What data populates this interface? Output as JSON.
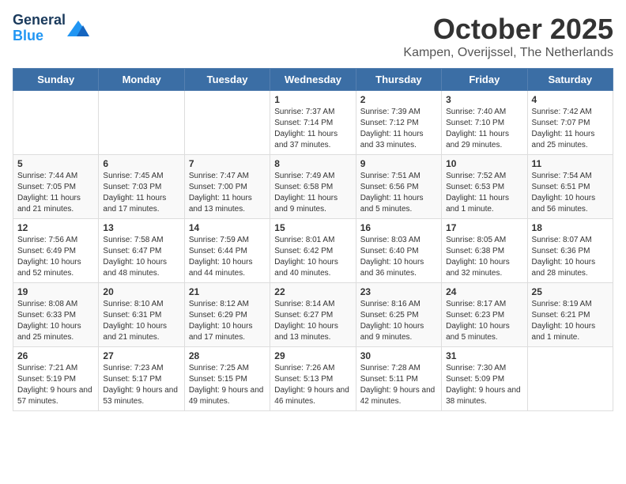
{
  "app": {
    "name": "GeneralBlue",
    "logo_color": "#2196f3"
  },
  "header": {
    "month": "October 2025",
    "location": "Kampen, Overijssel, The Netherlands"
  },
  "weekdays": [
    "Sunday",
    "Monday",
    "Tuesday",
    "Wednesday",
    "Thursday",
    "Friday",
    "Saturday"
  ],
  "weeks": [
    [
      {
        "day": "",
        "info": ""
      },
      {
        "day": "",
        "info": ""
      },
      {
        "day": "",
        "info": ""
      },
      {
        "day": "1",
        "info": "Sunrise: 7:37 AM\nSunset: 7:14 PM\nDaylight: 11 hours and 37 minutes."
      },
      {
        "day": "2",
        "info": "Sunrise: 7:39 AM\nSunset: 7:12 PM\nDaylight: 11 hours and 33 minutes."
      },
      {
        "day": "3",
        "info": "Sunrise: 7:40 AM\nSunset: 7:10 PM\nDaylight: 11 hours and 29 minutes."
      },
      {
        "day": "4",
        "info": "Sunrise: 7:42 AM\nSunset: 7:07 PM\nDaylight: 11 hours and 25 minutes."
      }
    ],
    [
      {
        "day": "5",
        "info": "Sunrise: 7:44 AM\nSunset: 7:05 PM\nDaylight: 11 hours and 21 minutes."
      },
      {
        "day": "6",
        "info": "Sunrise: 7:45 AM\nSunset: 7:03 PM\nDaylight: 11 hours and 17 minutes."
      },
      {
        "day": "7",
        "info": "Sunrise: 7:47 AM\nSunset: 7:00 PM\nDaylight: 11 hours and 13 minutes."
      },
      {
        "day": "8",
        "info": "Sunrise: 7:49 AM\nSunset: 6:58 PM\nDaylight: 11 hours and 9 minutes."
      },
      {
        "day": "9",
        "info": "Sunrise: 7:51 AM\nSunset: 6:56 PM\nDaylight: 11 hours and 5 minutes."
      },
      {
        "day": "10",
        "info": "Sunrise: 7:52 AM\nSunset: 6:53 PM\nDaylight: 11 hours and 1 minute."
      },
      {
        "day": "11",
        "info": "Sunrise: 7:54 AM\nSunset: 6:51 PM\nDaylight: 10 hours and 56 minutes."
      }
    ],
    [
      {
        "day": "12",
        "info": "Sunrise: 7:56 AM\nSunset: 6:49 PM\nDaylight: 10 hours and 52 minutes."
      },
      {
        "day": "13",
        "info": "Sunrise: 7:58 AM\nSunset: 6:47 PM\nDaylight: 10 hours and 48 minutes."
      },
      {
        "day": "14",
        "info": "Sunrise: 7:59 AM\nSunset: 6:44 PM\nDaylight: 10 hours and 44 minutes."
      },
      {
        "day": "15",
        "info": "Sunrise: 8:01 AM\nSunset: 6:42 PM\nDaylight: 10 hours and 40 minutes."
      },
      {
        "day": "16",
        "info": "Sunrise: 8:03 AM\nSunset: 6:40 PM\nDaylight: 10 hours and 36 minutes."
      },
      {
        "day": "17",
        "info": "Sunrise: 8:05 AM\nSunset: 6:38 PM\nDaylight: 10 hours and 32 minutes."
      },
      {
        "day": "18",
        "info": "Sunrise: 8:07 AM\nSunset: 6:36 PM\nDaylight: 10 hours and 28 minutes."
      }
    ],
    [
      {
        "day": "19",
        "info": "Sunrise: 8:08 AM\nSunset: 6:33 PM\nDaylight: 10 hours and 25 minutes."
      },
      {
        "day": "20",
        "info": "Sunrise: 8:10 AM\nSunset: 6:31 PM\nDaylight: 10 hours and 21 minutes."
      },
      {
        "day": "21",
        "info": "Sunrise: 8:12 AM\nSunset: 6:29 PM\nDaylight: 10 hours and 17 minutes."
      },
      {
        "day": "22",
        "info": "Sunrise: 8:14 AM\nSunset: 6:27 PM\nDaylight: 10 hours and 13 minutes."
      },
      {
        "day": "23",
        "info": "Sunrise: 8:16 AM\nSunset: 6:25 PM\nDaylight: 10 hours and 9 minutes."
      },
      {
        "day": "24",
        "info": "Sunrise: 8:17 AM\nSunset: 6:23 PM\nDaylight: 10 hours and 5 minutes."
      },
      {
        "day": "25",
        "info": "Sunrise: 8:19 AM\nSunset: 6:21 PM\nDaylight: 10 hours and 1 minute."
      }
    ],
    [
      {
        "day": "26",
        "info": "Sunrise: 7:21 AM\nSunset: 5:19 PM\nDaylight: 9 hours and 57 minutes."
      },
      {
        "day": "27",
        "info": "Sunrise: 7:23 AM\nSunset: 5:17 PM\nDaylight: 9 hours and 53 minutes."
      },
      {
        "day": "28",
        "info": "Sunrise: 7:25 AM\nSunset: 5:15 PM\nDaylight: 9 hours and 49 minutes."
      },
      {
        "day": "29",
        "info": "Sunrise: 7:26 AM\nSunset: 5:13 PM\nDaylight: 9 hours and 46 minutes."
      },
      {
        "day": "30",
        "info": "Sunrise: 7:28 AM\nSunset: 5:11 PM\nDaylight: 9 hours and 42 minutes."
      },
      {
        "day": "31",
        "info": "Sunrise: 7:30 AM\nSunset: 5:09 PM\nDaylight: 9 hours and 38 minutes."
      },
      {
        "day": "",
        "info": ""
      }
    ]
  ]
}
